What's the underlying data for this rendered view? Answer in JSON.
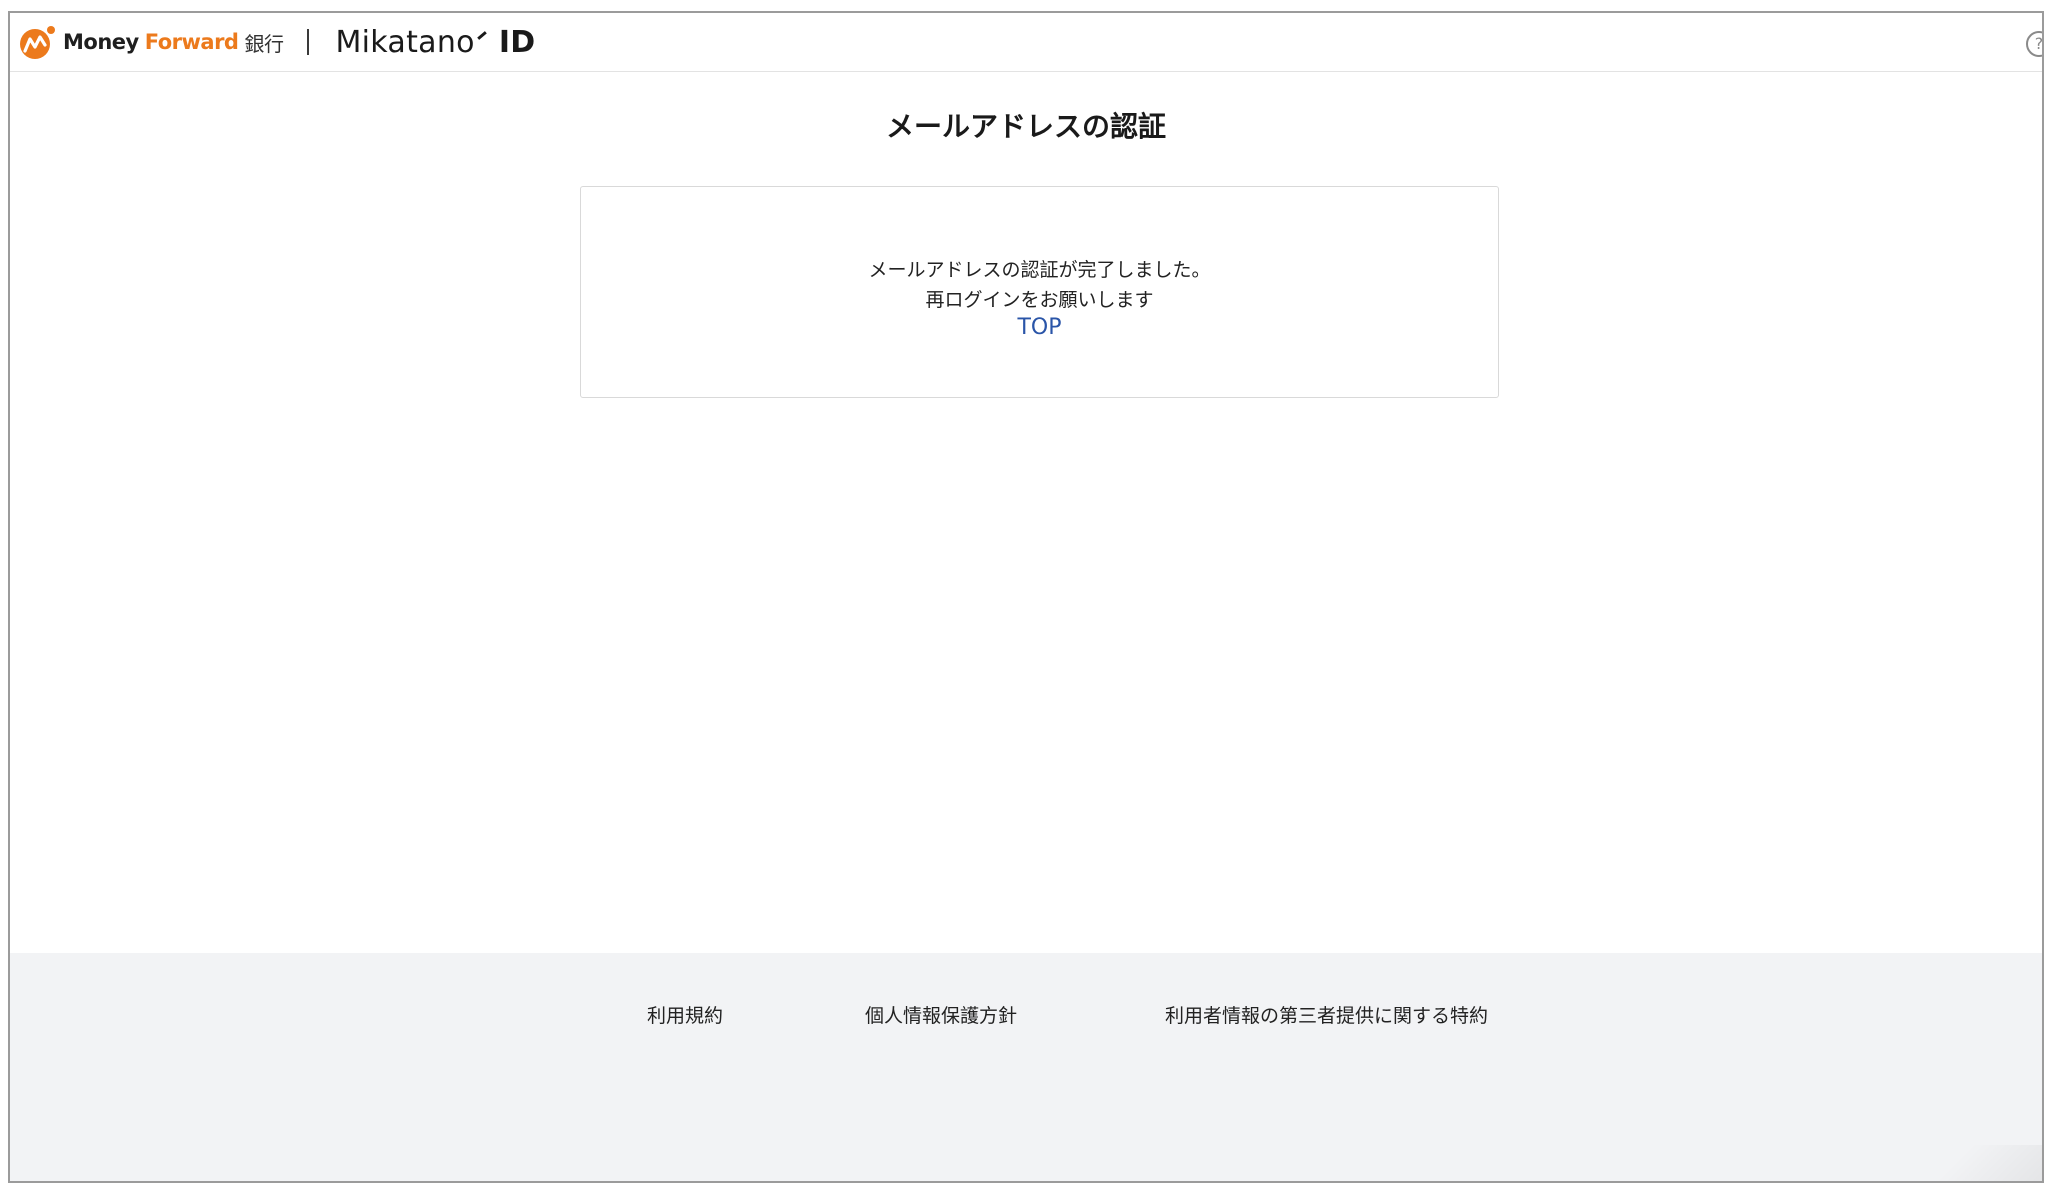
{
  "header": {
    "brand_money": "Money",
    "brand_forward": "Forward",
    "brand_bank": "銀行",
    "product_name": "Mikatano",
    "product_suffix": "ID",
    "help_glyph": "?",
    "accent_color": "#ec7a1c"
  },
  "main": {
    "title": "メールアドレスの認証",
    "message_line1": "メールアドレスの認証が完了しました。",
    "message_line2": "再ログインをお願いします",
    "top_link": "TOP",
    "link_color": "#2a55a8"
  },
  "footer": {
    "links": [
      {
        "label": "利用規約"
      },
      {
        "label": "個人情報保護方針"
      },
      {
        "label": "利用者情報の第三者提供に関する特約"
      }
    ],
    "background_color": "#f2f3f5"
  },
  "icons": [
    "money-forward-logo-icon",
    "help-icon"
  ]
}
